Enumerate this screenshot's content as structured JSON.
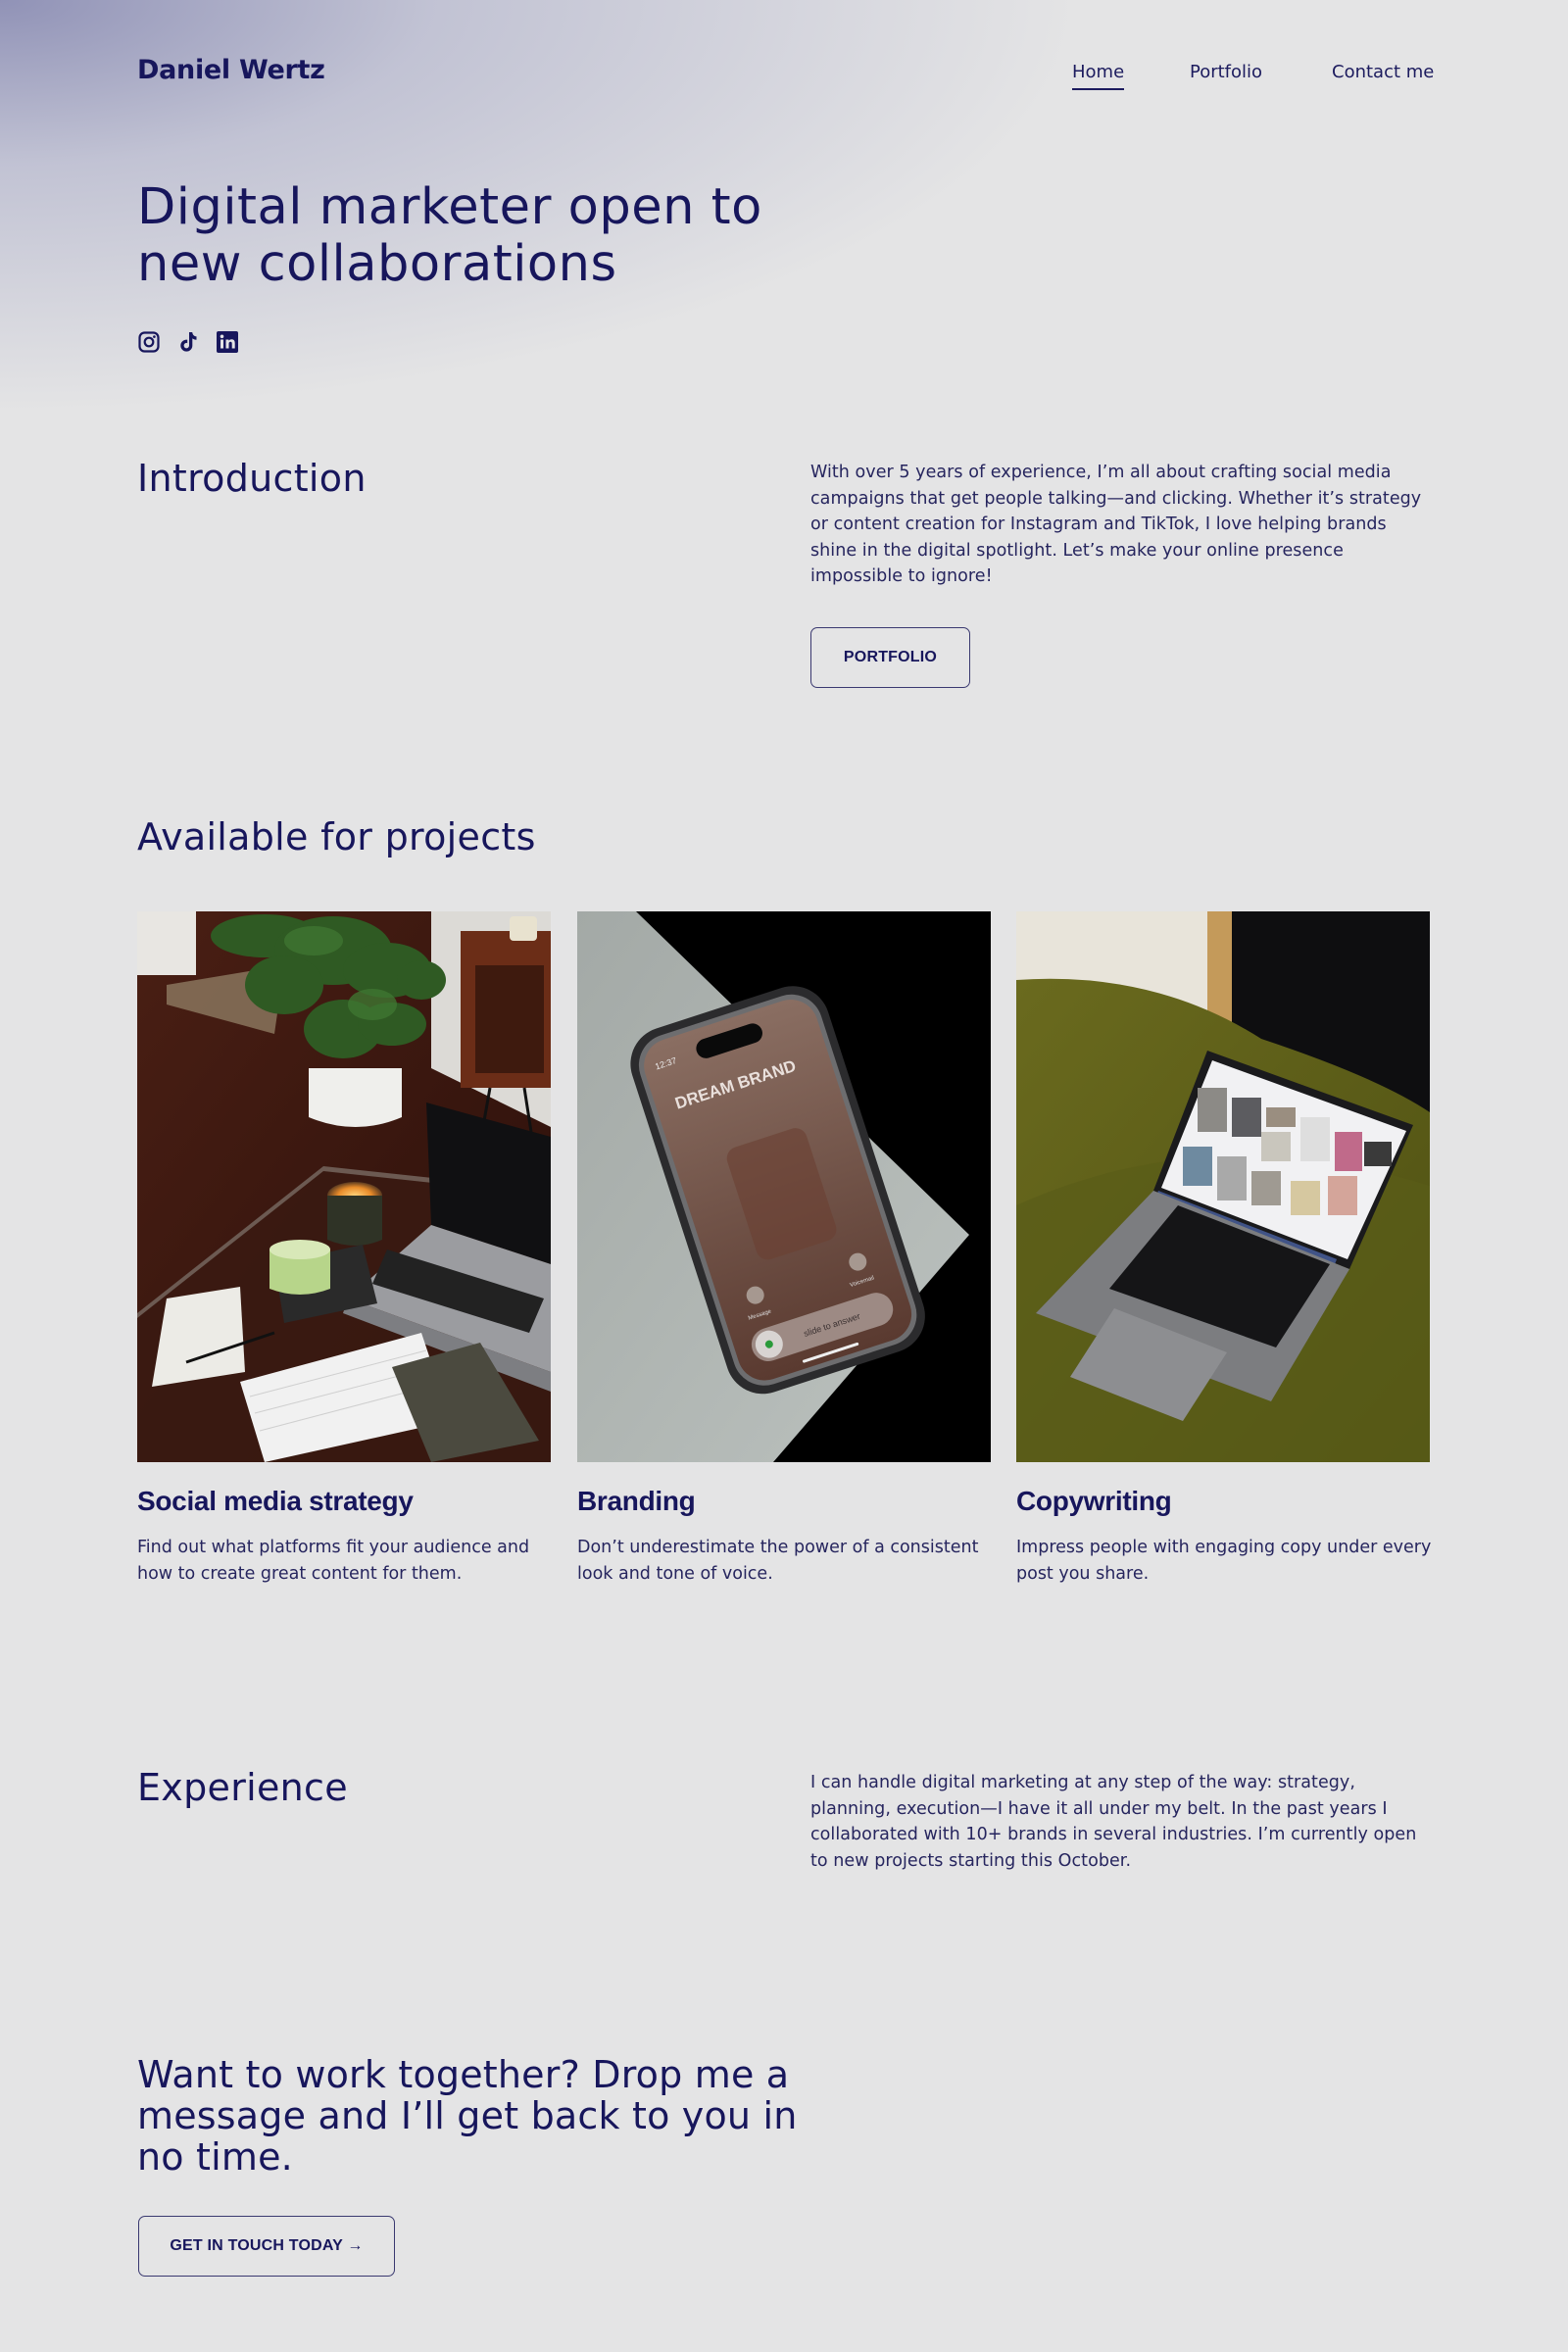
{
  "header": {
    "logo": "Daniel Wertz",
    "nav": [
      {
        "label": "Home",
        "active": true
      },
      {
        "label": "Portfolio",
        "active": false
      },
      {
        "label": "Contact me",
        "active": false
      }
    ]
  },
  "hero": {
    "title": "Digital marketer open to new collaborations",
    "socials": [
      {
        "icon": "instagram-icon"
      },
      {
        "icon": "tiktok-icon"
      },
      {
        "icon": "linkedin-icon"
      }
    ]
  },
  "intro": {
    "title": "Introduction",
    "text": "With over 5 years of experience, I’m all about crafting social media campaigns that get people talking—and clicking. Whether it’s strategy or content creation for Instagram and TikTok, I love helping brands shine in the digital spotlight. Let’s make your online presence impossible to ignore!",
    "button": "PORTFOLIO"
  },
  "projects": {
    "title": "Available for projects",
    "cards": [
      {
        "title": "Social media strategy",
        "description": "Find out what platforms fit your audience and how to create great content for them.",
        "image": "desk with plant, candle, matcha and laptop"
      },
      {
        "title": "Branding",
        "description": "Don’t underestimate the power of a consistent look and tone of voice.",
        "image": "phone showing incoming call from DREAM BRAND",
        "phone": {
          "time": "12:37",
          "caller": "DREAM BRAND",
          "message": "Message",
          "voicemail": "Voicemail",
          "slider": "slide to answer"
        }
      },
      {
        "title": "Copywriting",
        "description": "Impress people with engaging copy under every post you share.",
        "image": "laptop on green velvet armchair"
      }
    ]
  },
  "experience": {
    "title": "Experience",
    "text": "I can handle digital marketing at any step of the way: strategy, planning, execution—I have it all under my belt. In the past years I collaborated with 10+ brands in several industries. I’m currently open to new projects starting this October."
  },
  "cta": {
    "title": "Want to work together? Drop me a message and I’ll get back to you in no time.",
    "button": "GET IN TOUCH TODAY →"
  },
  "colors": {
    "primary": "#17165c",
    "background": "#e4e4e5"
  }
}
